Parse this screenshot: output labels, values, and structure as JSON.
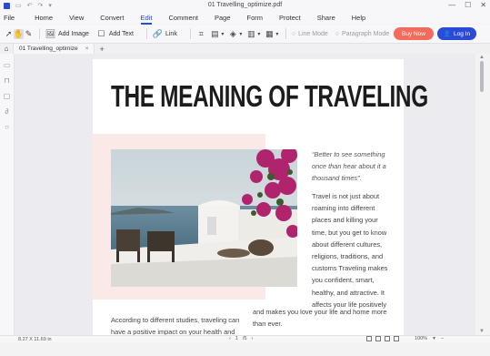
{
  "window": {
    "title": "01 Travelling_optimize.pdf",
    "minimize": "—",
    "maximize": "☐",
    "close": "✕"
  },
  "menu": {
    "items": [
      "File",
      "Home",
      "View",
      "Convert",
      "Edit",
      "Comment",
      "Page",
      "Form",
      "Protect",
      "Share",
      "Help"
    ],
    "active": "Edit"
  },
  "toolbar": {
    "add_image": "Add Image",
    "add_text": "Add Text",
    "link": "Link",
    "line_mode": "Line Mode",
    "paragraph_mode": "Paragraph Mode",
    "buy_now": "Buy Now",
    "login": "Log In"
  },
  "tabs": {
    "doc_tab_label": "01 Travelling_optimize",
    "close": "×",
    "new": "+"
  },
  "document": {
    "title": "THE MEANING OF TRAVELING",
    "quote": "“Better to see something once than hear about it a thousand times”.",
    "para1": "Travel is not just about roaming into different places and killing your time, but you get to know about different cultures, religions, traditions, and customs Traveling makes you confident, smart, healthy, and attractive. It affects your life positively",
    "para1_cont": "and makes you love your life and home more than ever.",
    "para2": "According to different studies, traveling can have a positive impact on your health and"
  },
  "status": {
    "page_size": "8.27 X 11.69 in",
    "page_current": "1",
    "page_total": "/5",
    "zoom": "100%"
  },
  "colors": {
    "accent": "#2a4bd7",
    "buy": "#f26b5b",
    "pink": "#fbe9e8"
  }
}
